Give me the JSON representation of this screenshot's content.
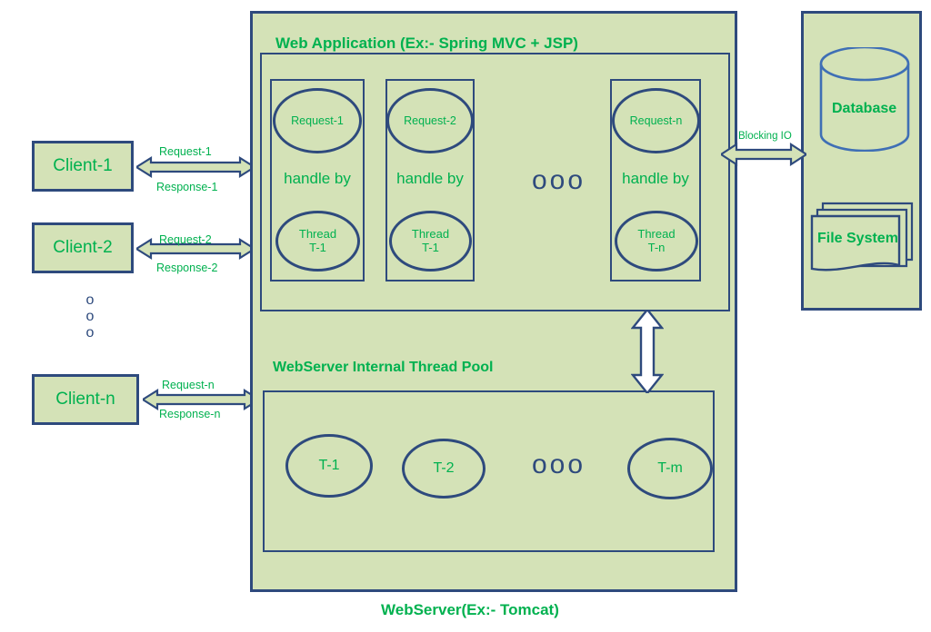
{
  "diagram": {
    "caption": "WebServer(Ex:- Tomcat)",
    "colors": {
      "fill_green": "#d4e2b7",
      "stroke_navy": "#2e4a7d",
      "text_green": "#00b14f",
      "db_stroke_blue": "#3f6fb5",
      "background": "#ffffff"
    }
  },
  "clients": {
    "items": [
      {
        "label": "Client-1",
        "request": "Request-1",
        "response": "Response-1"
      },
      {
        "label": "Client-2",
        "request": "Request-2",
        "response": "Response-2"
      },
      {
        "label": "Client-n",
        "request": "Request-n",
        "response": "Response-n"
      }
    ],
    "ellipsis": "o\no\no"
  },
  "webserver": {
    "caption": "WebServer(Ex:- Tomcat)",
    "web_application": {
      "title": "Web Application (Ex:- Spring MVC + JSP)",
      "handle_by_label": "handle by",
      "ellipsis": "ooo",
      "units": [
        {
          "request": "Request-1",
          "handle_by": "handle by",
          "thread_line1": "Thread",
          "thread_line2": "T-1"
        },
        {
          "request": "Request-2",
          "handle_by": "handle by",
          "thread_line1": "Thread",
          "thread_line2": "T-1"
        },
        {
          "request": "Request-n",
          "handle_by": "handle by",
          "thread_line1": "Thread",
          "thread_line2": "T-n"
        }
      ]
    },
    "thread_pool": {
      "title": "WebServer Internal Thread Pool",
      "ellipsis": "ooo",
      "threads": [
        {
          "label": "T-1"
        },
        {
          "label": "T-2"
        },
        {
          "label": "T-m"
        }
      ]
    }
  },
  "storage": {
    "blocking_io_label": "Blocking IO",
    "database_label": "Database",
    "file_system_label": "File System"
  }
}
